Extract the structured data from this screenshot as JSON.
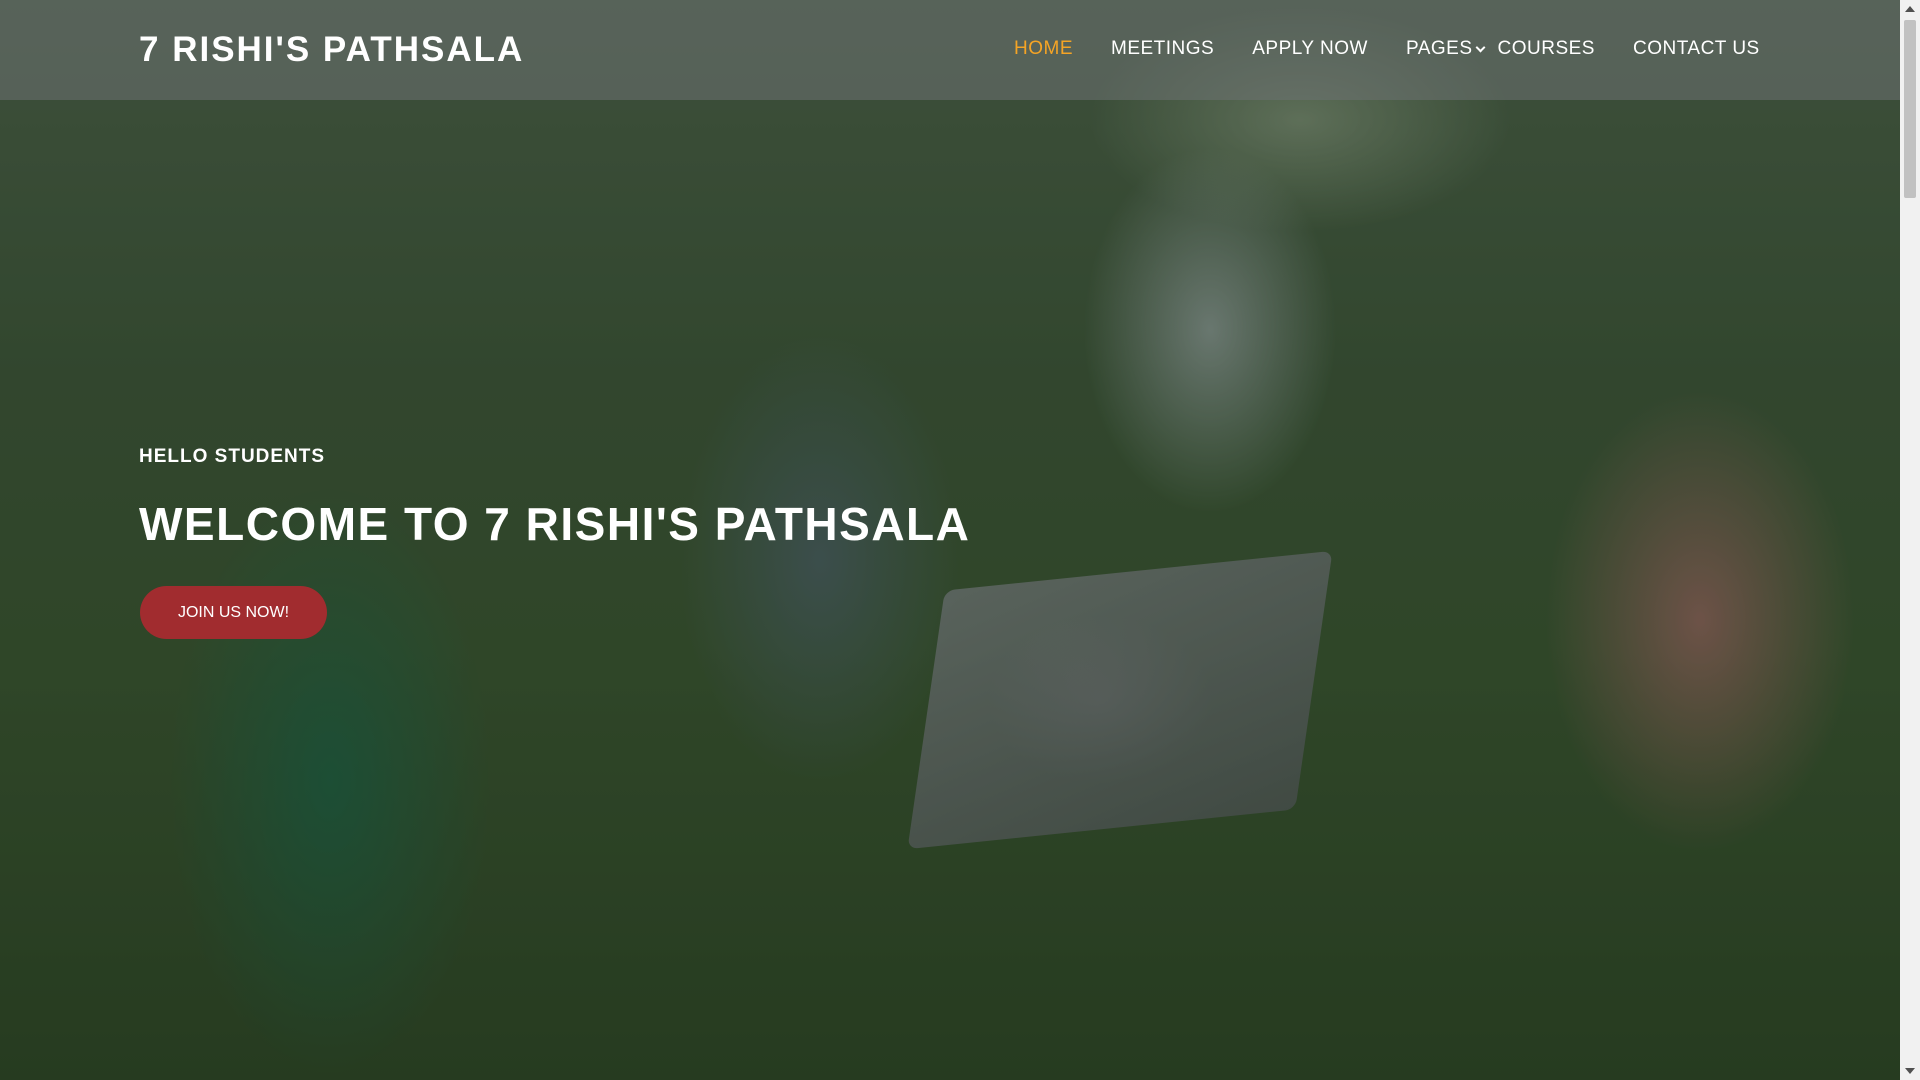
{
  "header": {
    "logo": "7 RISHI'S PATHSALA",
    "nav": {
      "home": "HOME",
      "meetings": "MEETINGS",
      "apply": "APPLY NOW",
      "pages": "PAGES",
      "courses": "COURSES",
      "contact": "CONTACT US"
    },
    "active_color": "#f5a425",
    "pages_icon": "chevron-down-icon"
  },
  "hero": {
    "subtitle": "HELLO STUDENTS",
    "title": "WELCOME TO 7 RISHI'S PATHSALA",
    "cta_label": "JOIN US NOW!",
    "cta_color": "#a12c2f"
  }
}
